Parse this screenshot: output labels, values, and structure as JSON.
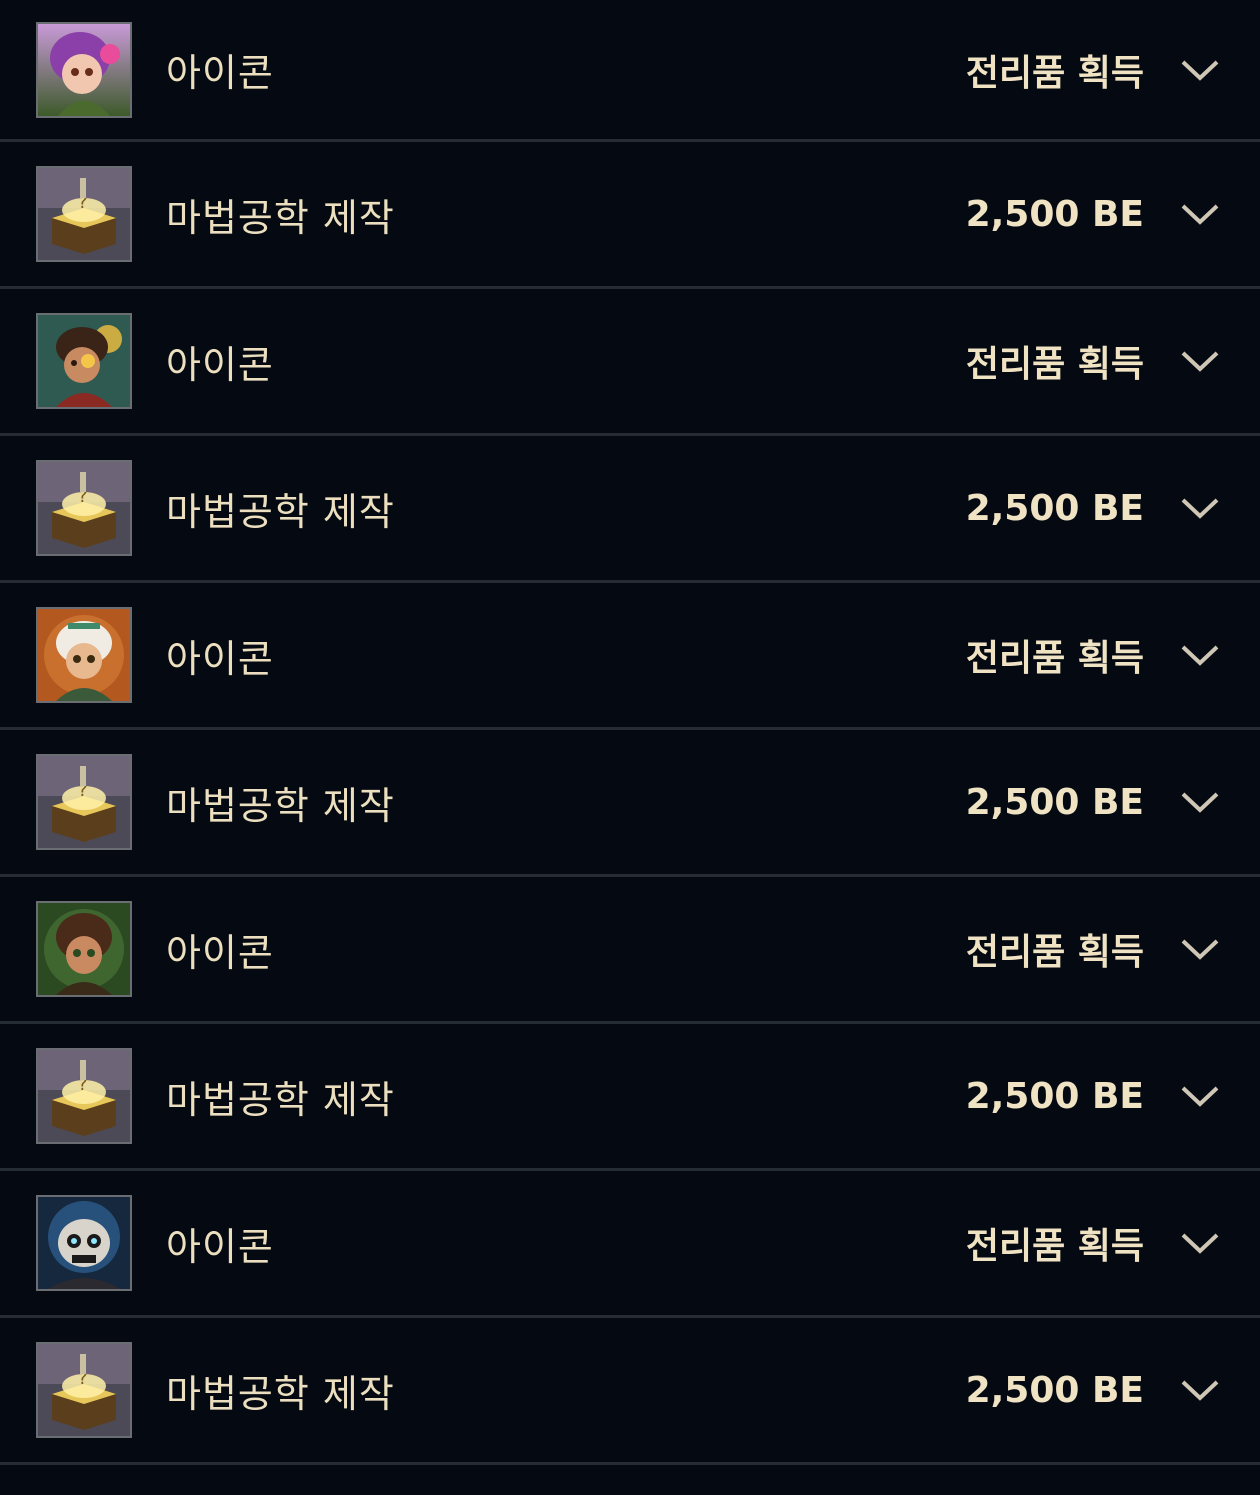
{
  "rows": [
    {
      "title": "아이콘",
      "value": "전리품 획득",
      "icon": "champion-icon-neeko",
      "kind": "icon"
    },
    {
      "title": "마법공학 제작",
      "value": "2,500 BE",
      "icon": "hextech-chest-icon",
      "kind": "craft"
    },
    {
      "title": "아이콘",
      "value": "전리품 획득",
      "icon": "champion-icon-ekko",
      "kind": "icon"
    },
    {
      "title": "마법공학 제작",
      "value": "2,500 BE",
      "icon": "hextech-chest-icon",
      "kind": "craft"
    },
    {
      "title": "아이콘",
      "value": "전리품 획득",
      "icon": "champion-icon-qiyana",
      "kind": "icon"
    },
    {
      "title": "마법공학 제작",
      "value": "2,500 BE",
      "icon": "hextech-chest-icon",
      "kind": "craft"
    },
    {
      "title": "아이콘",
      "value": "전리품 획득",
      "icon": "champion-icon-taliyah",
      "kind": "icon"
    },
    {
      "title": "마법공학 제작",
      "value": "2,500 BE",
      "icon": "hextech-chest-icon",
      "kind": "craft"
    },
    {
      "title": "아이콘",
      "value": "전리품 획득",
      "icon": "champion-icon-skull",
      "kind": "icon"
    },
    {
      "title": "마법공학 제작",
      "value": "2,500 BE",
      "icon": "hextech-chest-icon",
      "kind": "craft"
    }
  ],
  "colors": {
    "background": "#050a12",
    "divider": "#262c34",
    "text": "#ecdfbf",
    "chevron": "#cfc6b5"
  }
}
